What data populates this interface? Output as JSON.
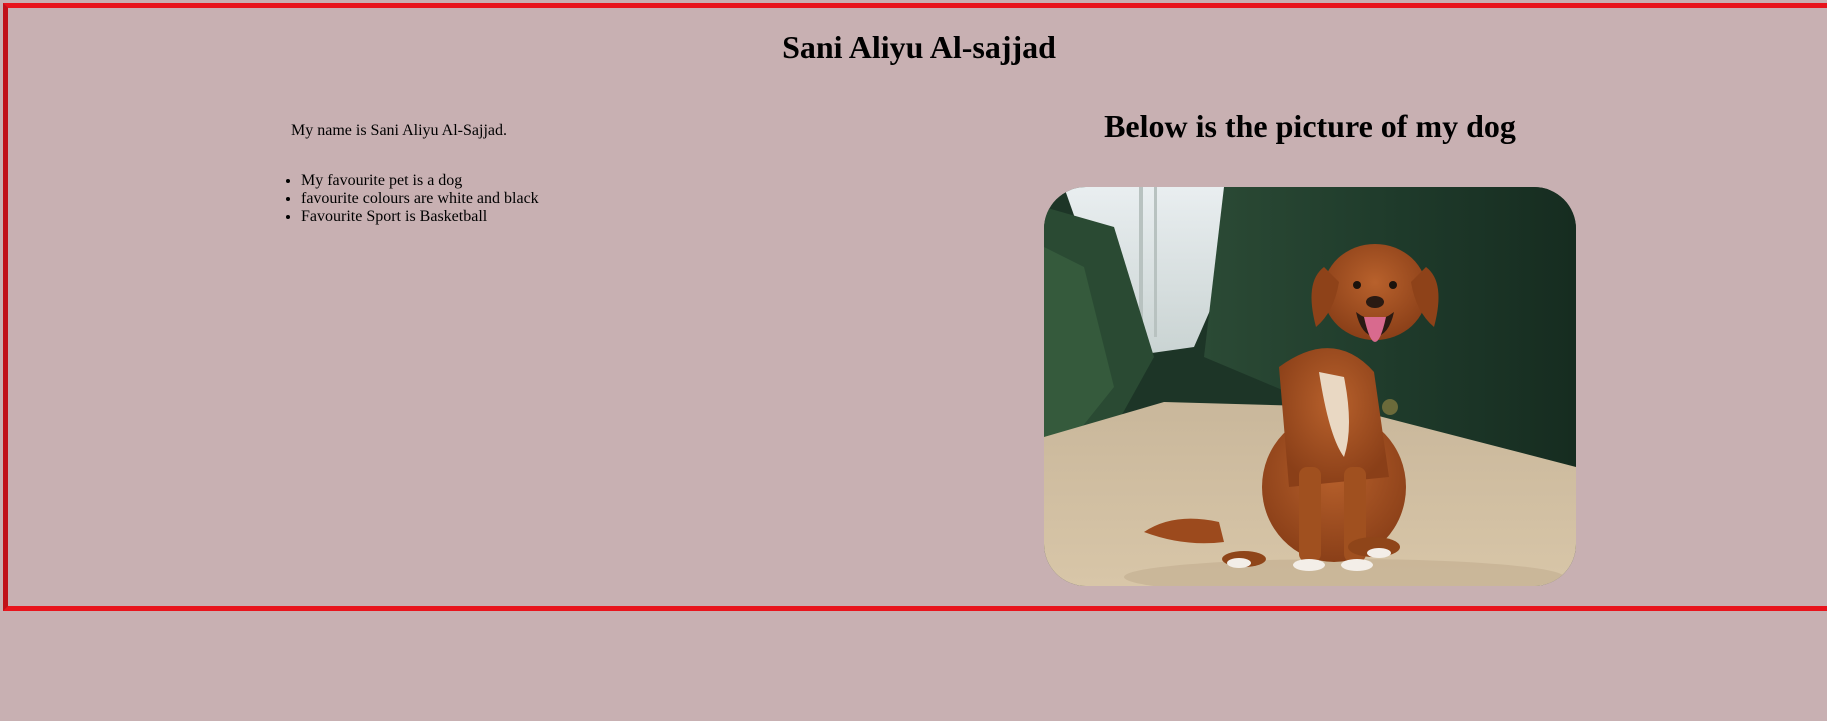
{
  "header": {
    "title": "Sani Aliyu Al-sajjad"
  },
  "about": {
    "intro": "My name is Sani Aliyu Al-Sajjad.",
    "facts": [
      "My favourite pet is a dog",
      "favourite colours are white and black",
      "Favourite Sport is Basketball"
    ]
  },
  "gallery": {
    "heading": "Below is the picture of my dog",
    "photo_icon": "dog-photo"
  },
  "colors": {
    "page_background": "#c8b0b2",
    "frame_border": "#e8141c"
  }
}
